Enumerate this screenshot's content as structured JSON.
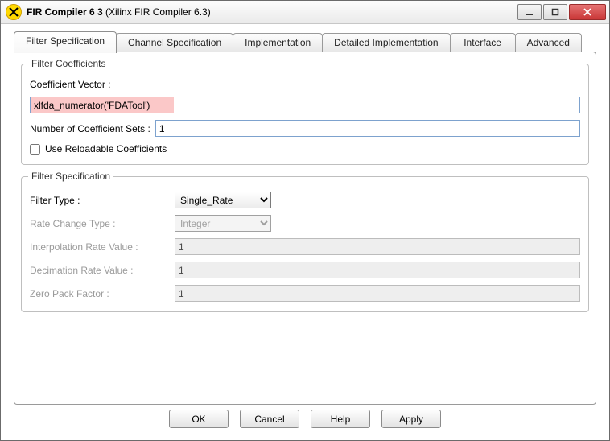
{
  "window": {
    "title_bold": "FIR Compiler 6 3",
    "title_rest": "  (Xilinx FIR Compiler 6.3)"
  },
  "tabs": [
    {
      "label": "Filter Specification"
    },
    {
      "label": "Channel Specification"
    },
    {
      "label": "Implementation"
    },
    {
      "label": "Detailed Implementation"
    },
    {
      "label": "Interface"
    },
    {
      "label": "Advanced"
    }
  ],
  "group_filter_coefficients": {
    "legend": "Filter Coefficients",
    "coefficient_vector_label": "Coefficient Vector :",
    "coefficient_vector_value": "xlfda_numerator('FDATool')",
    "num_sets_label": "Number of Coefficient Sets :",
    "num_sets_value": "1",
    "reloadable_label": "Use Reloadable Coefficients",
    "reloadable_checked": false
  },
  "group_filter_spec": {
    "legend": "Filter Specification",
    "filter_type_label": "Filter Type :",
    "filter_type_options": [
      "Single_Rate"
    ],
    "filter_type_value": "Single_Rate",
    "rate_change_label": "Rate Change Type :",
    "rate_change_options": [
      "Integer"
    ],
    "rate_change_value": "Integer",
    "interp_label": "Interpolation Rate Value :",
    "interp_value": "1",
    "decim_label": "Decimation Rate Value :",
    "decim_value": "1",
    "zero_pack_label": "Zero Pack Factor :",
    "zero_pack_value": "1"
  },
  "buttons": {
    "ok": "OK",
    "cancel": "Cancel",
    "help": "Help",
    "apply": "Apply"
  }
}
